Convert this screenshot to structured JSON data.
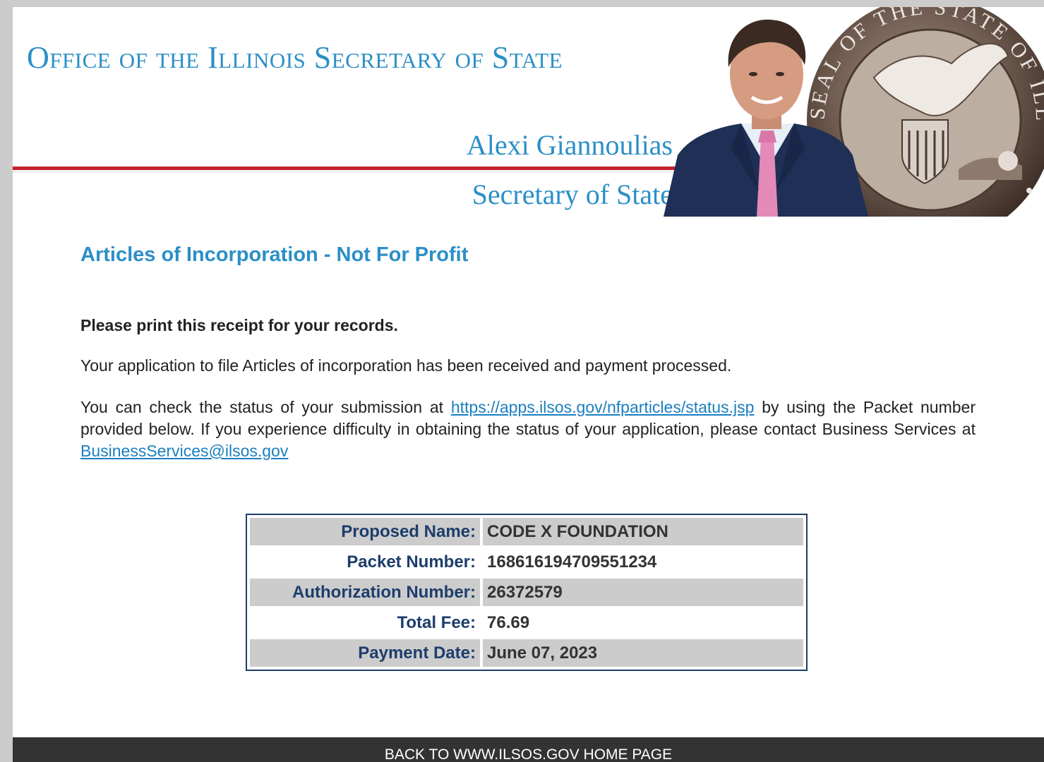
{
  "banner": {
    "office_title": "Office of the  Illinois Secretary of State",
    "name": "Alexi Giannoulias",
    "role": "Secretary of State",
    "seal_text": "SEAL OF THE STATE OF ILLINOIS",
    "colors": {
      "title_blue": "#2b8fc7",
      "rule_red": "#c8202f"
    }
  },
  "main": {
    "heading": "Articles of Incorporation - Not For Profit",
    "print_notice": "Please print this receipt for your records.",
    "received_text": "Your application to file Articles of incorporation has been received and payment processed.",
    "status_text_before": "You can check the status of your submission at ",
    "status_link": "https://apps.ilsos.gov/nfparticles/status.jsp",
    "status_text_middle": " by using the Packet number provided below. If you experience difficulty in obtaining the status of your application, please contact Business Services at ",
    "email_link": "BusinessServices@ilsos.gov"
  },
  "receipt": {
    "rows": [
      {
        "label": "Proposed Name:",
        "value": "CODE X FOUNDATION"
      },
      {
        "label": "Packet Number:",
        "value": "168616194709551234"
      },
      {
        "label": "Authorization Number:",
        "value": "26372579"
      },
      {
        "label": "Total Fee:",
        "value": "76.69"
      },
      {
        "label": "Payment Date:",
        "value": "June 07, 2023"
      }
    ],
    "colors": {
      "label": "#1d3d6b",
      "shade": "#cccccc"
    }
  },
  "footer": {
    "link": "BACK TO WWW.ILSOS.GOV HOME PAGE"
  }
}
